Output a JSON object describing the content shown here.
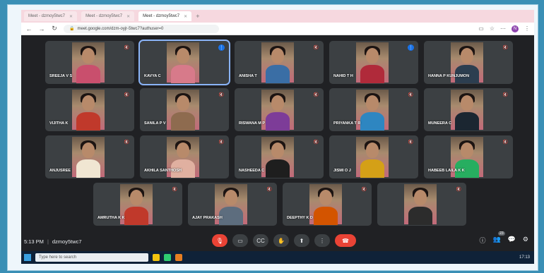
{
  "browser": {
    "tabs": [
      {
        "label": "Meet - dzmoy5twc7",
        "active": false
      },
      {
        "label": "Meet - dzmoy5twc7",
        "active": false
      },
      {
        "label": "Meet - dzmoy5twc7",
        "active": true
      }
    ],
    "url": "meet.google.com/dzm-oyjr-5twc7?authuser=0",
    "profile_initial": "N"
  },
  "participants": [
    {
      "name": "SREEJA V S",
      "speaking": false
    },
    {
      "name": "KAVYA C",
      "speaking": true
    },
    {
      "name": "ANISHA T",
      "speaking": false
    },
    {
      "name": "NAHID T H",
      "speaking": true
    },
    {
      "name": "HANNA P KUNJUMON",
      "speaking": false
    },
    {
      "name": "VIJITHA K",
      "speaking": false
    },
    {
      "name": "SANILA P V",
      "speaking": false
    },
    {
      "name": "RISWANA M P",
      "speaking": false
    },
    {
      "name": "PRIYANKA T R",
      "speaking": false
    },
    {
      "name": "MUNEERA C",
      "speaking": false
    },
    {
      "name": "ANJUSREE",
      "speaking": false
    },
    {
      "name": "AKHILA SANTHOSH",
      "speaking": false
    },
    {
      "name": "NASHEEDA C",
      "speaking": false
    },
    {
      "name": "JISMI O J",
      "speaking": false
    },
    {
      "name": "HABEEB LAILA K K",
      "speaking": false
    },
    {
      "name": "AMRUTHA K K",
      "speaking": false
    },
    {
      "name": "AJAY PRAKASH",
      "speaking": false
    },
    {
      "name": "DEEPTHY K D",
      "speaking": false
    },
    {
      "name": "",
      "speaking": false
    }
  ],
  "bottom": {
    "time": "5:13 PM",
    "meeting_code": "dzmoy5twc7",
    "people_count": "23"
  },
  "taskbar": {
    "search_placeholder": "Type here to search",
    "clock": "17:13"
  },
  "icons": {
    "mic": "mic-off-icon",
    "camera": "camera-icon",
    "captions": "captions-icon",
    "raise_hand": "raise-hand-icon",
    "present": "present-icon",
    "more": "more-options-icon",
    "leave": "leave-call-icon",
    "info": "info-icon",
    "people": "people-icon",
    "chat": "chat-icon",
    "activities": "activities-icon"
  },
  "colors": {
    "meet_bg": "#202124",
    "tile_bg": "#3c4043",
    "accent_blue": "#1a73e8",
    "leave_red": "#ea4335"
  }
}
